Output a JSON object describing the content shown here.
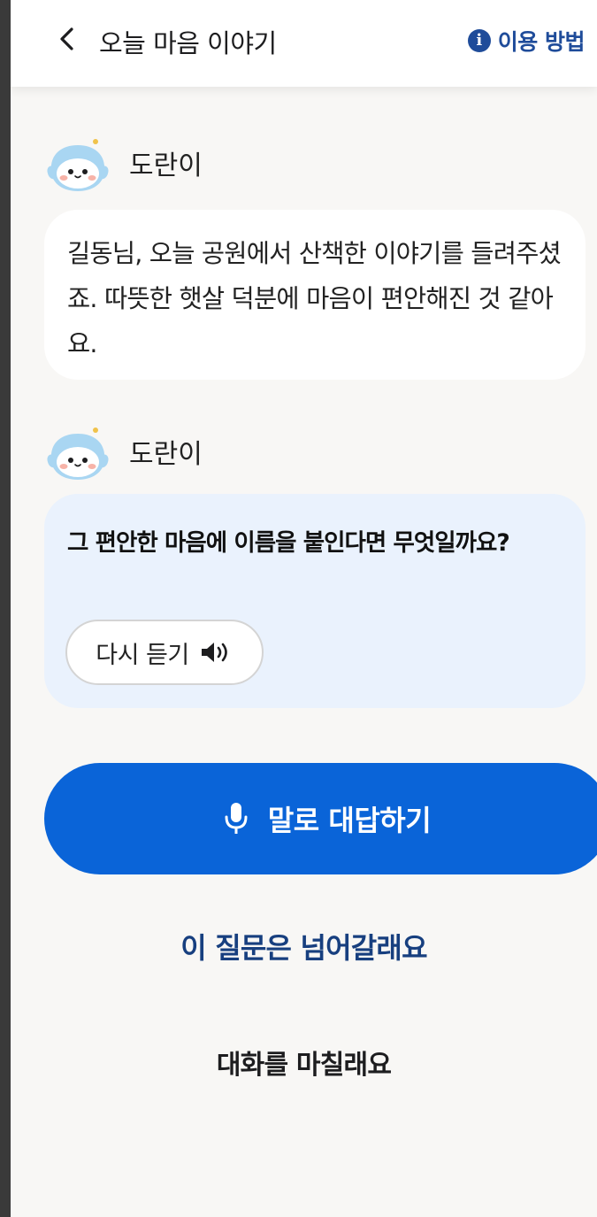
{
  "header": {
    "title": "오늘 마음 이야기",
    "help_label": "이용 방법",
    "help_icon": "info-icon",
    "back_icon": "chevron-left-icon"
  },
  "messages": [
    {
      "speaker": "도란이",
      "avatar": "doranee-avatar",
      "text": "길동님, 오늘 공원에서 산책한 이야기를 들려주셨죠. 따뜻한 햇살 덕분에 마음이 편안해진 것 같아요."
    },
    {
      "speaker": "도란이",
      "avatar": "doranee-avatar",
      "text": "그 편안한 마음에 이름을 붙인다면 무엇일까요?",
      "relisten_label": "다시 듣기",
      "relisten_icon": "speaker-icon"
    }
  ],
  "actions": {
    "answer_label": "말로 대답하기",
    "answer_icon": "microphone-icon",
    "skip_label": "이 질문은 넘어갈래요",
    "end_label": "대화를 마칠래요"
  },
  "colors": {
    "primary": "#0a64d8",
    "link": "#173f7f",
    "help": "#1f4c9a",
    "question_bubble": "#eaf2fd",
    "background": "#f8f7f5"
  }
}
